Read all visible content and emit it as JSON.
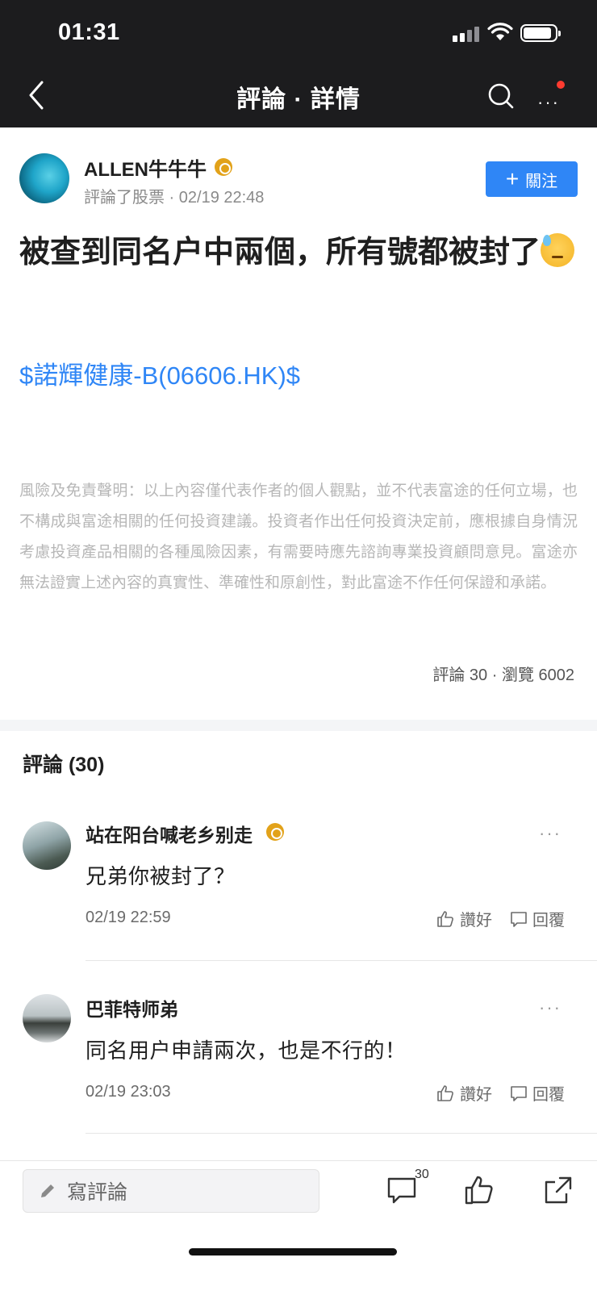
{
  "status_bar": {
    "time": "01:31"
  },
  "nav": {
    "title": "評論 · 詳情"
  },
  "post": {
    "author": "ALLEN牛牛牛",
    "meta": "評論了股票 · 02/19 22:48",
    "follow_label": "關注",
    "title": "被查到同名户中兩個，所有號都被封了",
    "stock_link": "$諾輝健康-B(06606.HK)$",
    "disclaimer": "風險及免責聲明：以上內容僅代表作者的個人觀點，並不代表富途的任何立場，也不構成與富途相關的任何投資建議。投資者作出任何投資決定前，應根據自身情況考慮投資產品相關的各種風險因素，有需要時應先諮詢專業投資顧問意見。富途亦無法證實上述內容的真實性、準確性和原創性，對此富途不作任何保證和承諾。",
    "stats": "評論 30 · 瀏覽 6002"
  },
  "comments_section": {
    "header": "評論 (30)",
    "items": [
      {
        "name": "站在阳台喊老乡别走",
        "text": "兄弟你被封了？",
        "time": "02/19 22:59",
        "like_label": "讚好",
        "reply_label": "回覆"
      },
      {
        "name": "巴菲特师弟",
        "text": "同名用户申請兩次，也是不行的！",
        "time": "02/19 23:03",
        "like_label": "讚好",
        "reply_label": "回覆"
      }
    ]
  },
  "bottom_bar": {
    "compose_placeholder": "寫評論",
    "comment_count": "30"
  },
  "colors": {
    "accent": "#2f86f6",
    "badge": "#e2a21a",
    "notify_dot": "#ff3b30",
    "topbar": "#1c1c1e"
  }
}
